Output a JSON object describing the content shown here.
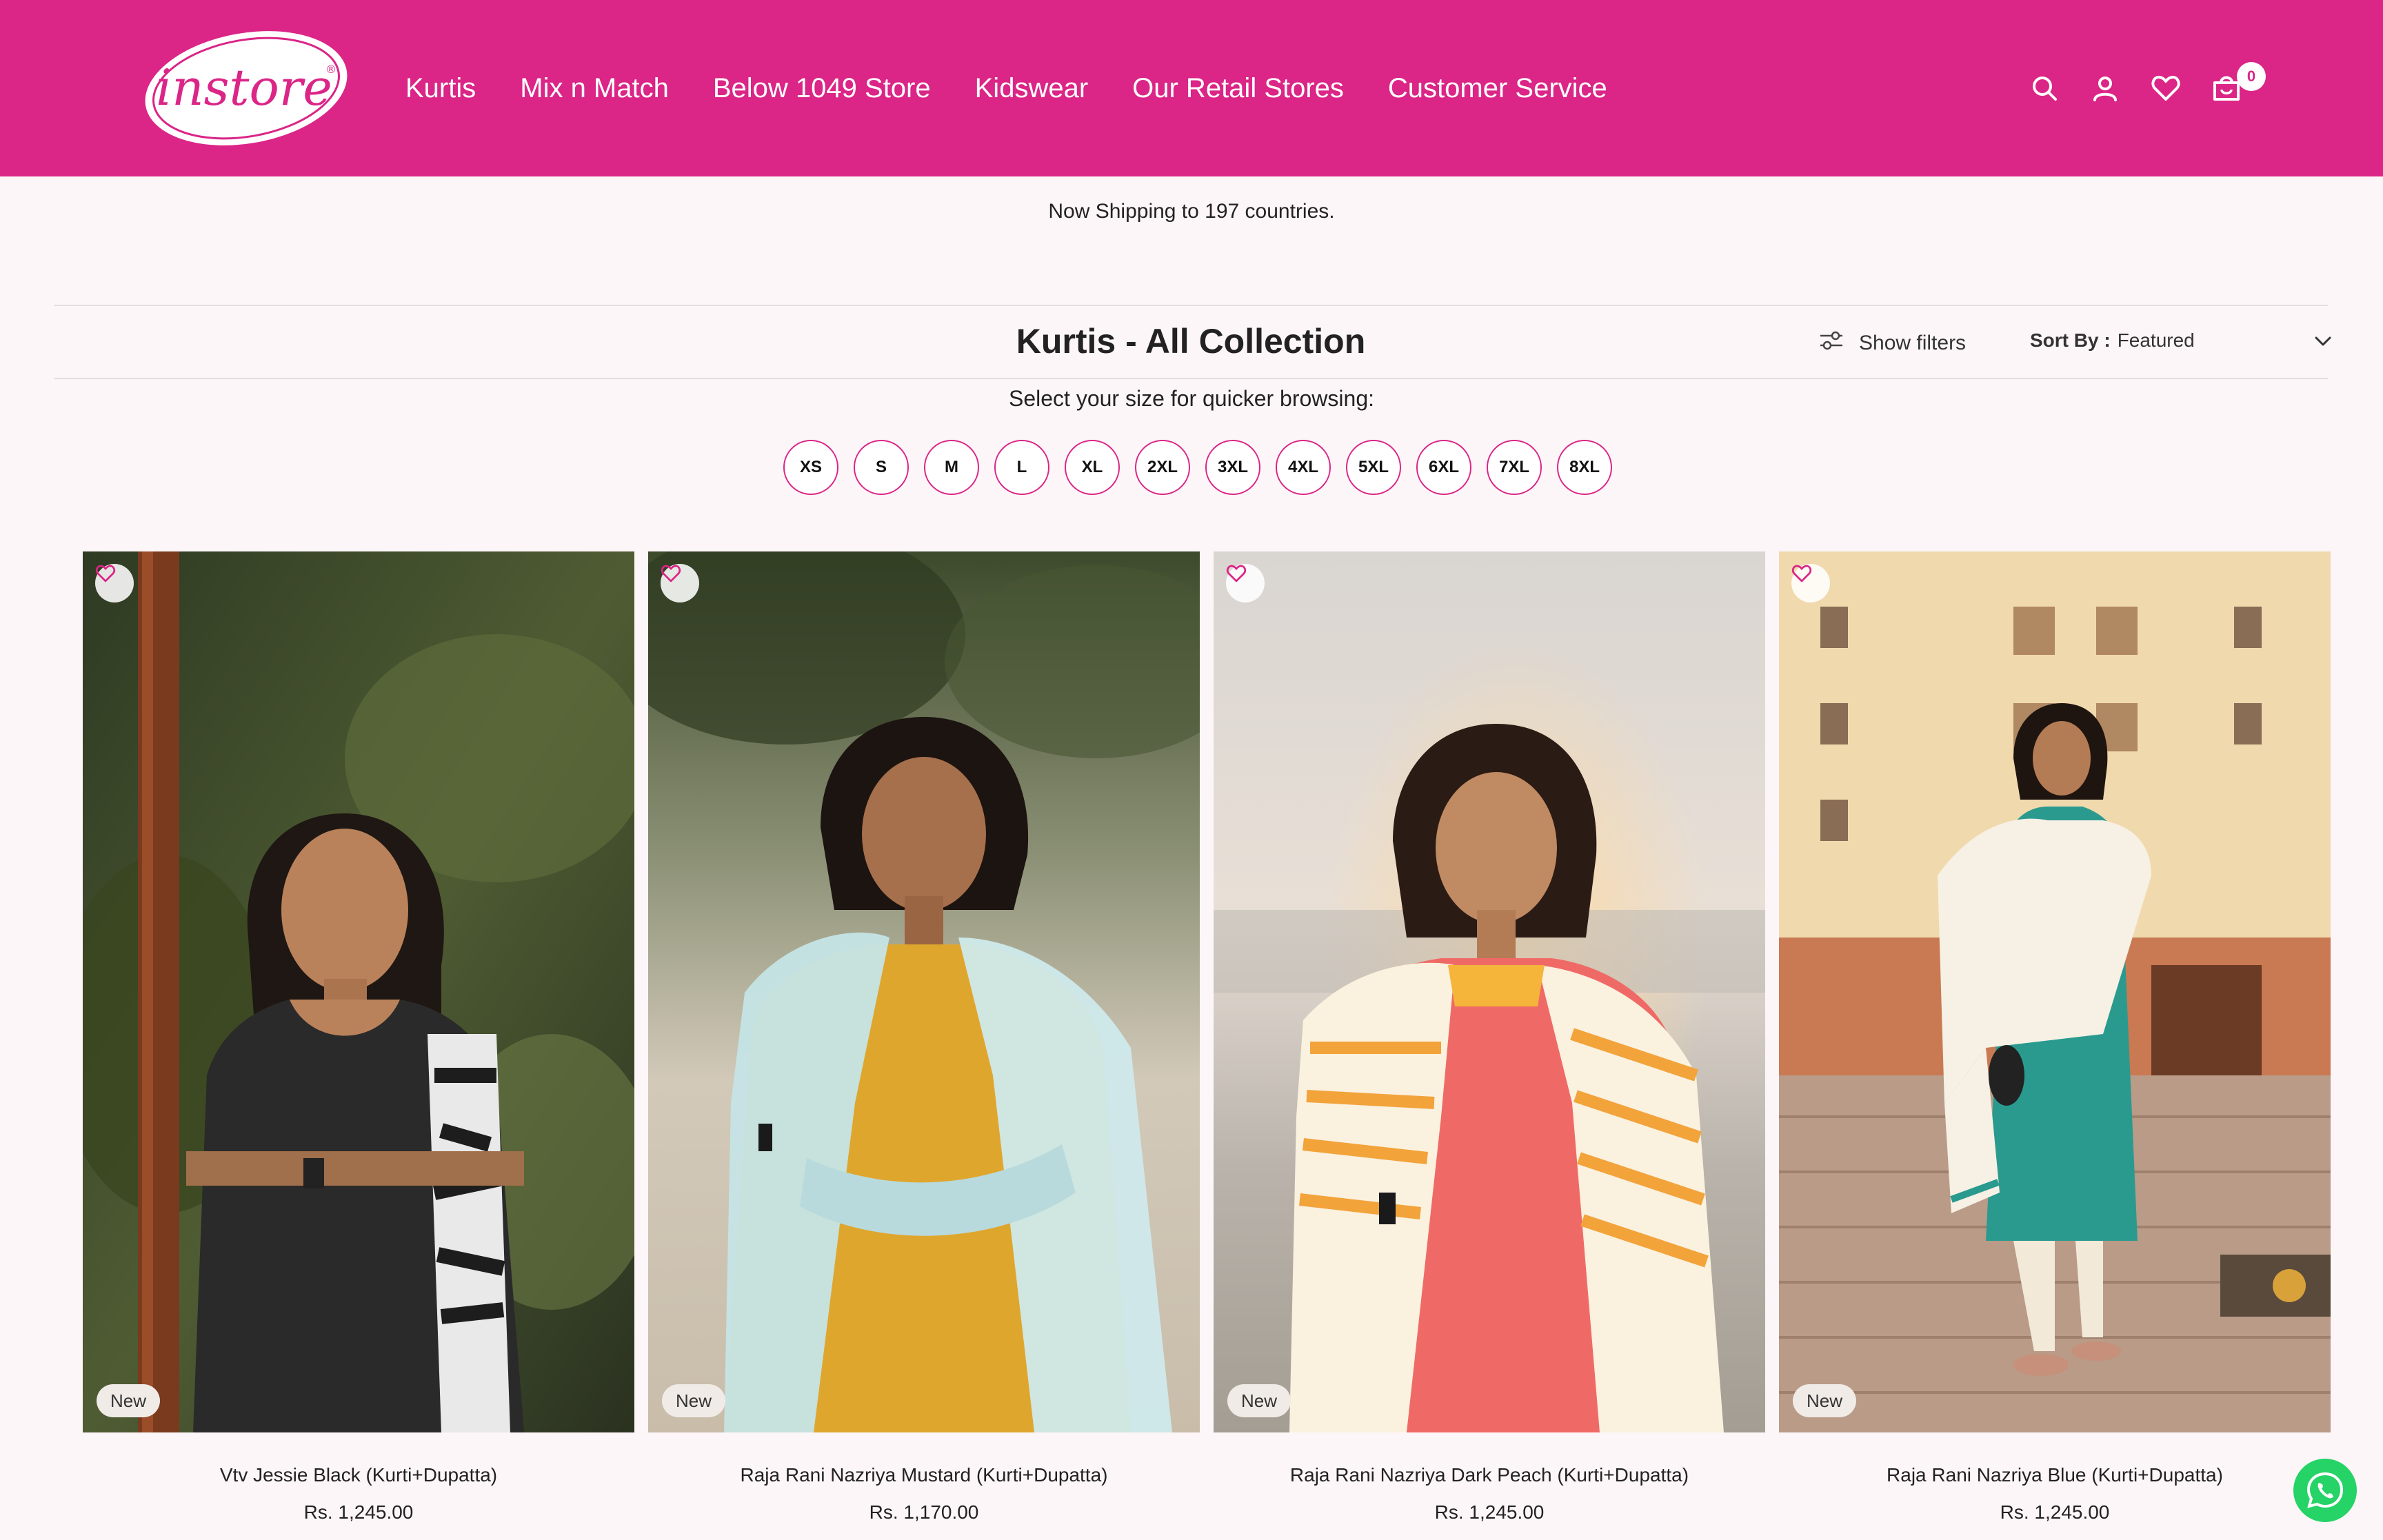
{
  "header": {
    "logo_text": "instore",
    "nav": [
      "Kurtis",
      "Mix n Match",
      "Below 1049 Store",
      "Kidswear",
      "Our Retail Stores",
      "Customer Service"
    ],
    "icons": [
      "search-icon",
      "account-icon",
      "wishlist-icon",
      "cart-icon"
    ],
    "cart_count": "0",
    "brand_color": "#db2587"
  },
  "announcement": "Now Shipping to 197 countries.",
  "collection": {
    "title": "Kurtis - All Collection",
    "filters_label": "Show filters",
    "sort_label": "Sort By :",
    "sort_value": "Featured"
  },
  "sizes": {
    "prompt": "Select your size for quicker browsing:",
    "options": [
      "XS",
      "S",
      "M",
      "L",
      "XL",
      "2XL",
      "3XL",
      "4XL",
      "5XL",
      "6XL",
      "7XL",
      "8XL"
    ]
  },
  "products": [
    {
      "name": "Vtv Jessie Black (Kurti+Dupatta)",
      "price": "Rs. 1,245.00",
      "badge": "New"
    },
    {
      "name": "Raja Rani Nazriya Mustard (Kurti+Dupatta)",
      "price": "Rs. 1,170.00",
      "badge": "New"
    },
    {
      "name": "Raja Rani Nazriya Dark Peach (Kurti+Dupatta)",
      "price": "Rs. 1,245.00",
      "badge": "New"
    },
    {
      "name": "Raja Rani Nazriya Blue (Kurti+Dupatta)",
      "price": "Rs. 1,245.00",
      "badge": "New"
    }
  ]
}
